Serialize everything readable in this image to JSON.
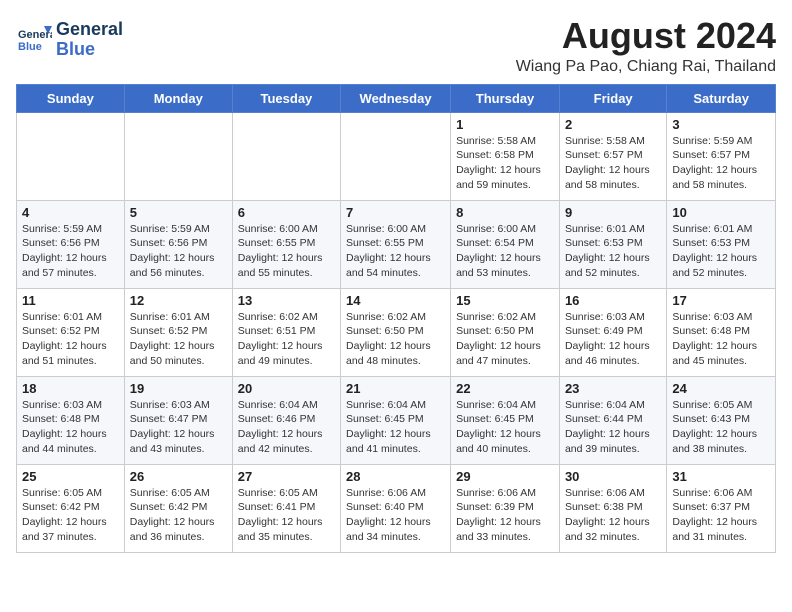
{
  "header": {
    "logo_line1": "General",
    "logo_line2": "Blue",
    "month_year": "August 2024",
    "location": "Wiang Pa Pao, Chiang Rai, Thailand"
  },
  "weekdays": [
    "Sunday",
    "Monday",
    "Tuesday",
    "Wednesday",
    "Thursday",
    "Friday",
    "Saturday"
  ],
  "weeks": [
    [
      {
        "day": "",
        "content": ""
      },
      {
        "day": "",
        "content": ""
      },
      {
        "day": "",
        "content": ""
      },
      {
        "day": "",
        "content": ""
      },
      {
        "day": "1",
        "content": "Sunrise: 5:58 AM\nSunset: 6:58 PM\nDaylight: 12 hours\nand 59 minutes."
      },
      {
        "day": "2",
        "content": "Sunrise: 5:58 AM\nSunset: 6:57 PM\nDaylight: 12 hours\nand 58 minutes."
      },
      {
        "day": "3",
        "content": "Sunrise: 5:59 AM\nSunset: 6:57 PM\nDaylight: 12 hours\nand 58 minutes."
      }
    ],
    [
      {
        "day": "4",
        "content": "Sunrise: 5:59 AM\nSunset: 6:56 PM\nDaylight: 12 hours\nand 57 minutes."
      },
      {
        "day": "5",
        "content": "Sunrise: 5:59 AM\nSunset: 6:56 PM\nDaylight: 12 hours\nand 56 minutes."
      },
      {
        "day": "6",
        "content": "Sunrise: 6:00 AM\nSunset: 6:55 PM\nDaylight: 12 hours\nand 55 minutes."
      },
      {
        "day": "7",
        "content": "Sunrise: 6:00 AM\nSunset: 6:55 PM\nDaylight: 12 hours\nand 54 minutes."
      },
      {
        "day": "8",
        "content": "Sunrise: 6:00 AM\nSunset: 6:54 PM\nDaylight: 12 hours\nand 53 minutes."
      },
      {
        "day": "9",
        "content": "Sunrise: 6:01 AM\nSunset: 6:53 PM\nDaylight: 12 hours\nand 52 minutes."
      },
      {
        "day": "10",
        "content": "Sunrise: 6:01 AM\nSunset: 6:53 PM\nDaylight: 12 hours\nand 52 minutes."
      }
    ],
    [
      {
        "day": "11",
        "content": "Sunrise: 6:01 AM\nSunset: 6:52 PM\nDaylight: 12 hours\nand 51 minutes."
      },
      {
        "day": "12",
        "content": "Sunrise: 6:01 AM\nSunset: 6:52 PM\nDaylight: 12 hours\nand 50 minutes."
      },
      {
        "day": "13",
        "content": "Sunrise: 6:02 AM\nSunset: 6:51 PM\nDaylight: 12 hours\nand 49 minutes."
      },
      {
        "day": "14",
        "content": "Sunrise: 6:02 AM\nSunset: 6:50 PM\nDaylight: 12 hours\nand 48 minutes."
      },
      {
        "day": "15",
        "content": "Sunrise: 6:02 AM\nSunset: 6:50 PM\nDaylight: 12 hours\nand 47 minutes."
      },
      {
        "day": "16",
        "content": "Sunrise: 6:03 AM\nSunset: 6:49 PM\nDaylight: 12 hours\nand 46 minutes."
      },
      {
        "day": "17",
        "content": "Sunrise: 6:03 AM\nSunset: 6:48 PM\nDaylight: 12 hours\nand 45 minutes."
      }
    ],
    [
      {
        "day": "18",
        "content": "Sunrise: 6:03 AM\nSunset: 6:48 PM\nDaylight: 12 hours\nand 44 minutes."
      },
      {
        "day": "19",
        "content": "Sunrise: 6:03 AM\nSunset: 6:47 PM\nDaylight: 12 hours\nand 43 minutes."
      },
      {
        "day": "20",
        "content": "Sunrise: 6:04 AM\nSunset: 6:46 PM\nDaylight: 12 hours\nand 42 minutes."
      },
      {
        "day": "21",
        "content": "Sunrise: 6:04 AM\nSunset: 6:45 PM\nDaylight: 12 hours\nand 41 minutes."
      },
      {
        "day": "22",
        "content": "Sunrise: 6:04 AM\nSunset: 6:45 PM\nDaylight: 12 hours\nand 40 minutes."
      },
      {
        "day": "23",
        "content": "Sunrise: 6:04 AM\nSunset: 6:44 PM\nDaylight: 12 hours\nand 39 minutes."
      },
      {
        "day": "24",
        "content": "Sunrise: 6:05 AM\nSunset: 6:43 PM\nDaylight: 12 hours\nand 38 minutes."
      }
    ],
    [
      {
        "day": "25",
        "content": "Sunrise: 6:05 AM\nSunset: 6:42 PM\nDaylight: 12 hours\nand 37 minutes."
      },
      {
        "day": "26",
        "content": "Sunrise: 6:05 AM\nSunset: 6:42 PM\nDaylight: 12 hours\nand 36 minutes."
      },
      {
        "day": "27",
        "content": "Sunrise: 6:05 AM\nSunset: 6:41 PM\nDaylight: 12 hours\nand 35 minutes."
      },
      {
        "day": "28",
        "content": "Sunrise: 6:06 AM\nSunset: 6:40 PM\nDaylight: 12 hours\nand 34 minutes."
      },
      {
        "day": "29",
        "content": "Sunrise: 6:06 AM\nSunset: 6:39 PM\nDaylight: 12 hours\nand 33 minutes."
      },
      {
        "day": "30",
        "content": "Sunrise: 6:06 AM\nSunset: 6:38 PM\nDaylight: 12 hours\nand 32 minutes."
      },
      {
        "day": "31",
        "content": "Sunrise: 6:06 AM\nSunset: 6:37 PM\nDaylight: 12 hours\nand 31 minutes."
      }
    ]
  ]
}
